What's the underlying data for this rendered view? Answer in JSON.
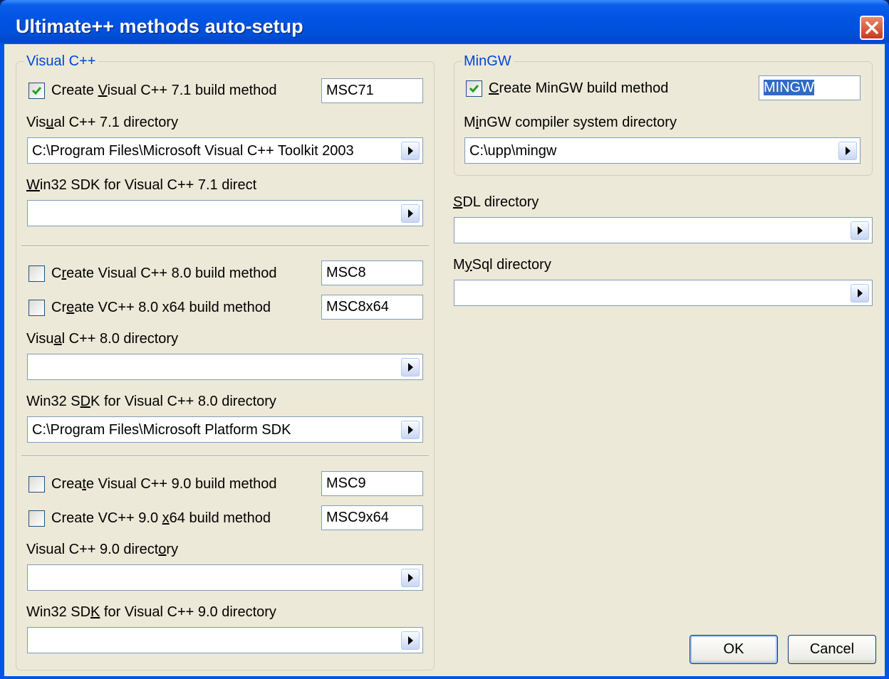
{
  "window": {
    "title": "Ultimate++ methods auto-setup"
  },
  "vc71_group": {
    "title": "Visual C++",
    "create_checkbox": {
      "label_pre": "Create ",
      "label_u": "V",
      "label_post": "isual C++ 7.1 build method",
      "checked": true
    },
    "method_name": "MSC71",
    "dir_label": {
      "pre": "Vis",
      "u": "u",
      "post": "al C++ 7.1 directory"
    },
    "dir_value": "C:\\Program Files\\Microsoft Visual C++ Toolkit 2003",
    "sdk_label": {
      "pre": "",
      "u": "W",
      "post": "in32 SDK for Visual C++ 7.1 direct"
    },
    "sdk_value": ""
  },
  "vc80": {
    "create_checkbox": {
      "label_pre": "C",
      "label_u": "r",
      "label_post": "eate Visual C++ 8.0 build method",
      "checked": false
    },
    "method_name": "MSC8",
    "create_x64_checkbox": {
      "label_pre": "Cr",
      "label_u": "e",
      "label_post": "ate VC++ 8.0 x64 build method",
      "checked": false
    },
    "method_x64_name": "MSC8x64",
    "dir_label": {
      "pre": "Visu",
      "u": "a",
      "post": "l C++ 8.0 directory"
    },
    "dir_value": "",
    "sdk_label": {
      "pre": "Win32 S",
      "u": "D",
      "post": "K for Visual C++ 8.0 directory"
    },
    "sdk_value": "C:\\Program Files\\Microsoft Platform SDK"
  },
  "vc90": {
    "create_checkbox": {
      "label_pre": "Crea",
      "label_u": "t",
      "label_post": "e Visual C++ 9.0 build method",
      "checked": false
    },
    "method_name": "MSC9",
    "create_x64_checkbox": {
      "label_pre": "Create VC++ 9.0 ",
      "label_u": "x",
      "label_post": "64 build method",
      "checked": false
    },
    "method_x64_name": "MSC9x64",
    "dir_label": {
      "pre": "Visual C++ 9.0 direct",
      "u": "o",
      "post": "ry"
    },
    "dir_value": "",
    "sdk_label": {
      "pre": "Win32 SD",
      "u": "K",
      "post": " for Visual C++ 9.0 directory"
    },
    "sdk_value": ""
  },
  "mingw_group": {
    "title": "MinGW",
    "create_checkbox": {
      "label_pre": "",
      "label_u": "C",
      "label_post": "reate MinGW build method",
      "checked": true
    },
    "method_name": "MINGW",
    "dir_label": {
      "pre": "M",
      "u": "i",
      "post": "nGW compiler system directory"
    },
    "dir_value": "C:\\upp\\mingw"
  },
  "sdl": {
    "label": {
      "pre": "",
      "u": "S",
      "post": "DL directory"
    },
    "value": ""
  },
  "mysql": {
    "label": {
      "pre": "M",
      "u": "y",
      "post": "Sql directory"
    },
    "value": ""
  },
  "buttons": {
    "ok": "OK",
    "cancel": "Cancel"
  },
  "icons": {
    "close": "close-icon",
    "dropdown": "triangle-right-icon",
    "check": "checkmark-icon"
  },
  "colors": {
    "titlebar": "#0054e3",
    "dialog_bg": "#ece9d8",
    "group_title": "#0046d5",
    "selection": "#316ac5",
    "close": "#c8391a"
  }
}
